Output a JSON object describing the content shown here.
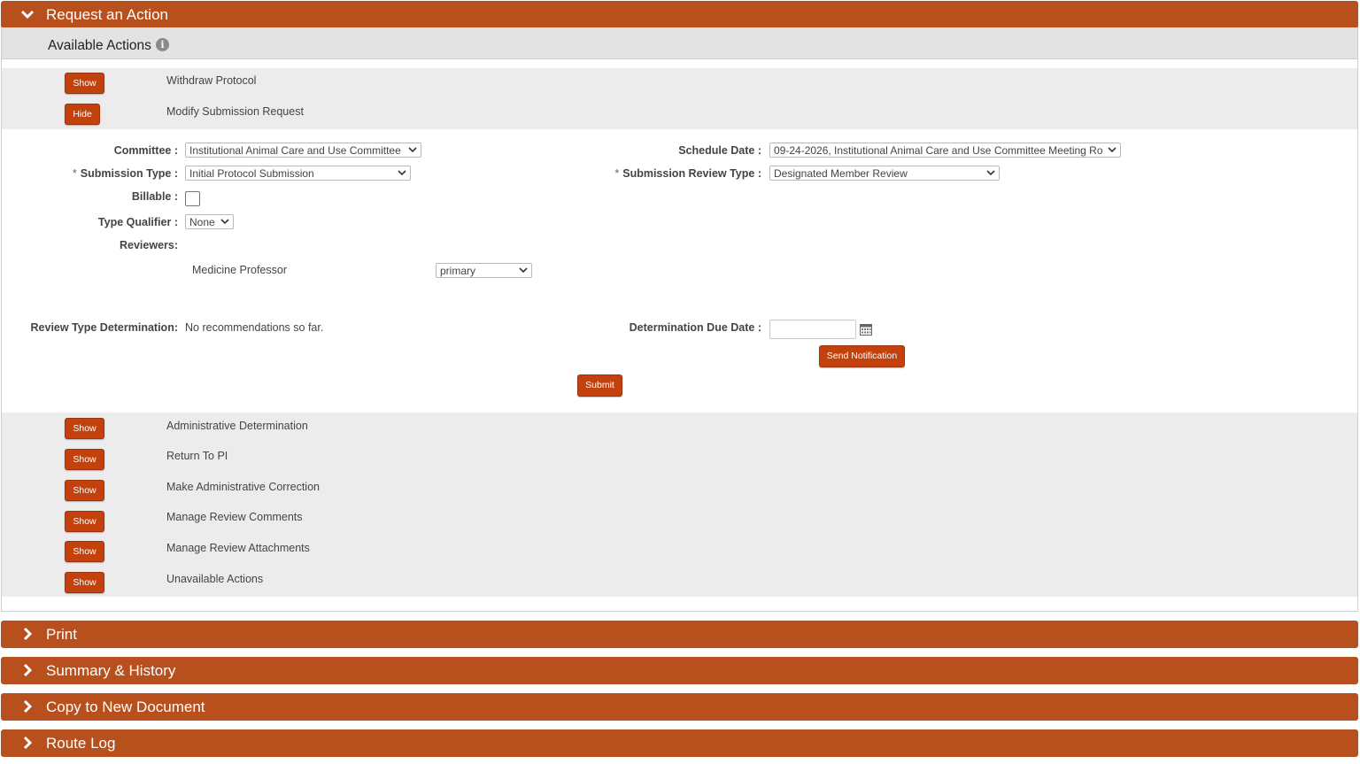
{
  "colors": {
    "accent": "#B7501D",
    "button": "#C2410C",
    "panel_gray": "#ececec"
  },
  "request_section": {
    "title": "Request an Action",
    "available_actions_label": "Available Actions",
    "info_icon": "i"
  },
  "actions_top": [
    {
      "button": "Show",
      "label": "Withdraw Protocol"
    },
    {
      "button": "Hide",
      "label": "Modify Submission Request"
    }
  ],
  "form": {
    "committee_label": "Committee :",
    "committee_value": "Institutional Animal Care and Use Committee",
    "schedule_date_label": "Schedule Date :",
    "schedule_date_value": "09-24-2026, Institutional Animal Care and Use Committee Meeting Ro",
    "required_marker": "*",
    "submission_type_label": "Submission Type :",
    "submission_type_value": "Initial Protocol Submission",
    "submission_review_type_label": "Submission Review Type :",
    "submission_review_type_value": "Designated Member Review",
    "billable_label": "Billable :",
    "type_qualifier_label": "Type Qualifier :",
    "type_qualifier_value": "None",
    "reviewers_label": "Reviewers:",
    "reviewer_name": "Medicine Professor",
    "reviewer_role": "primary",
    "review_type_determination_label": "Review Type Determination:",
    "review_type_determination_value": "No recommendations so far.",
    "determination_due_date_label": "Determination Due Date :",
    "send_notification_label": "Send Notification",
    "submit_label": "Submit"
  },
  "actions_bottom": [
    {
      "button": "Show",
      "label": "Administrative Determination"
    },
    {
      "button": "Show",
      "label": "Return To PI"
    },
    {
      "button": "Show",
      "label": "Make Administrative Correction"
    },
    {
      "button": "Show",
      "label": "Manage Review Comments"
    },
    {
      "button": "Show",
      "label": "Manage Review Attachments"
    },
    {
      "button": "Show",
      "label": "Unavailable Actions"
    }
  ],
  "collapsed_sections": [
    {
      "title": "Print"
    },
    {
      "title": "Summary & History"
    },
    {
      "title": "Copy to New Document"
    },
    {
      "title": "Route Log"
    }
  ]
}
